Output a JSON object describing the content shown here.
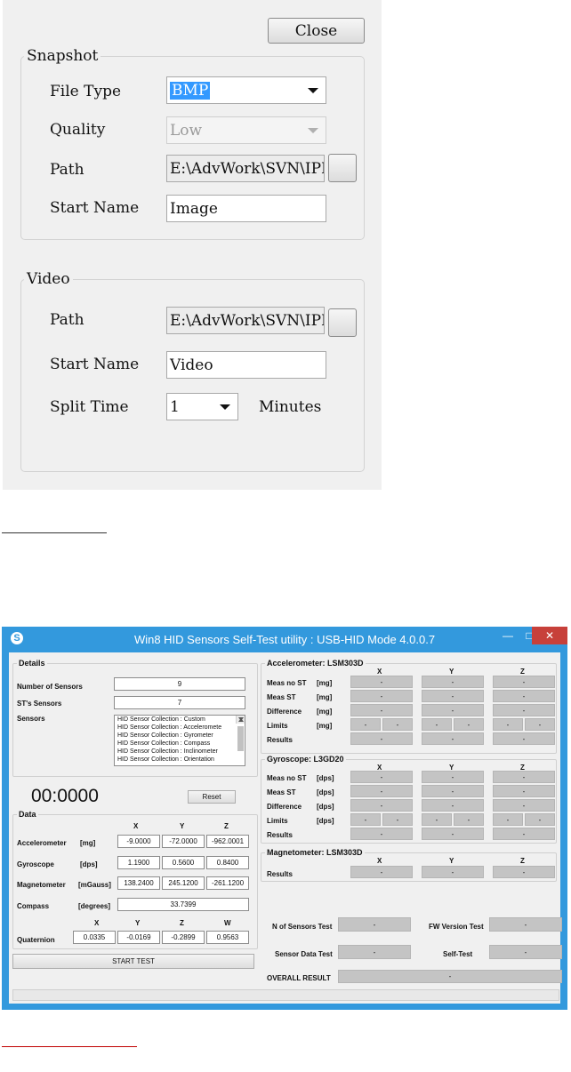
{
  "dialog": {
    "close_label": "Close",
    "snapshot": {
      "title": "Snapshot",
      "file_type_label": "File Type",
      "file_type_value": "BMP",
      "quality_label": "Quality",
      "quality_value": "Low",
      "path_label": "Path",
      "path_value": "E:\\AdvWork\\SVN\\IPD\\P",
      "start_name_label": "Start Name",
      "start_name_value": "Image"
    },
    "video": {
      "title": "Video",
      "path_label": "Path",
      "path_value": "E:\\AdvWork\\SVN\\IPD\\P",
      "start_name_label": "Start Name",
      "start_name_value": "Video",
      "split_time_label": "Split Time",
      "split_time_value": "1",
      "minutes_label": "Minutes"
    }
  },
  "app": {
    "title": "Win8 HID Sensors Self-Test utility : USB-HID Mode 4.0.0.7",
    "accent": "#3399dd",
    "details": {
      "title": "Details",
      "num_sensors_label": "Number of Sensors",
      "num_sensors_value": "9",
      "st_sensors_label": "ST's Sensors",
      "st_sensors_value": "7",
      "sensors_label": "Sensors",
      "sensors_list": [
        "HID Sensor Collection : Custom",
        "HID Sensor Collection : Acceleromete",
        "HID Sensor Collection : Gyrometer",
        "HID Sensor Collection : Compass",
        "HID Sensor Collection : Inclinometer",
        "HID Sensor Collection : Orientation"
      ]
    },
    "timer": "00:0000",
    "reset_label": "Reset",
    "data": {
      "title": "Data",
      "axes": [
        "X",
        "Y",
        "Z"
      ],
      "accelerometer": {
        "label": "Accelerometer",
        "unit": "[mg]",
        "values": [
          "-9.0000",
          "-72.0000",
          "-962.0001"
        ]
      },
      "gyroscope": {
        "label": "Gyroscope",
        "unit": "[dps]",
        "values": [
          "1.1900",
          "0.5600",
          "0.8400"
        ]
      },
      "magnetometer": {
        "label": "Magnetometer",
        "unit": "[mGauss]",
        "values": [
          "138.2400",
          "245.1200",
          "-261.1200"
        ]
      },
      "compass": {
        "label": "Compass",
        "unit": "[degrees]",
        "value": "33.7399"
      },
      "quaternion_axes": [
        "X",
        "Y",
        "Z",
        "W"
      ],
      "quaternion": {
        "label": "Quaternion",
        "values": [
          "0.0335",
          "-0.0169",
          "-0.2899",
          "0.9563"
        ]
      }
    },
    "start_test_label": "START TEST",
    "accel_test": {
      "title": "Accelerometer: LSM303D",
      "axes": [
        "X",
        "Y",
        "Z"
      ],
      "rows": [
        {
          "label": "Meas no ST",
          "unit": "[mg]"
        },
        {
          "label": "Meas ST",
          "unit": "[mg]"
        },
        {
          "label": "Difference",
          "unit": "[mg]"
        },
        {
          "label": "Limits",
          "unit": "[mg]"
        },
        {
          "label": "Results",
          "unit": ""
        }
      ]
    },
    "gyro_test": {
      "title": "Gyroscope: L3GD20",
      "axes": [
        "X",
        "Y",
        "Z"
      ],
      "rows": [
        {
          "label": "Meas no ST",
          "unit": "[dps]"
        },
        {
          "label": "Meas ST",
          "unit": "[dps]"
        },
        {
          "label": "Difference",
          "unit": "[dps]"
        },
        {
          "label": "Limits",
          "unit": "[dps]"
        },
        {
          "label": "Results",
          "unit": ""
        }
      ]
    },
    "mag_test": {
      "title": "Magnetometer: LSM303D",
      "axes": [
        "X",
        "Y",
        "Z"
      ],
      "results_label": "Results"
    },
    "cell_value": "-",
    "summary": {
      "n_sensors_label": "N of Sensors Test",
      "n_sensors_value": "-",
      "fw_version_label": "FW Version Test",
      "fw_version_value": "-",
      "sensor_data_label": "Sensor Data Test",
      "sensor_data_value": "-",
      "self_test_label": "Self-Test",
      "self_test_value": "-",
      "overall_label": "OVERALL RESULT",
      "overall_value": "-"
    }
  }
}
